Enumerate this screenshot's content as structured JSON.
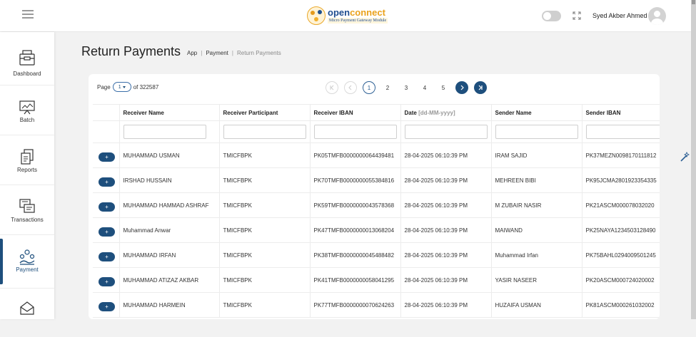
{
  "header": {
    "logo": {
      "name_part1": "open",
      "name_part2": "connect",
      "tagline": "Micro Payment Gateway Module"
    },
    "user_name": "Syed Akber Ahmed"
  },
  "sidebar": {
    "items": [
      {
        "label": "Dashboard",
        "icon": "dashboard-icon"
      },
      {
        "label": "Batch",
        "icon": "batch-icon"
      },
      {
        "label": "Reports",
        "icon": "reports-icon"
      },
      {
        "label": "Transactions",
        "icon": "transactions-icon"
      },
      {
        "label": "Payment",
        "icon": "payment-icon",
        "active": true
      },
      {
        "label": "",
        "icon": "inbox-icon"
      }
    ]
  },
  "page": {
    "title": "Return Payments",
    "breadcrumb": [
      "App",
      "Payment",
      "Return Payments"
    ]
  },
  "pagination": {
    "page_label": "Page",
    "current_page": "1",
    "of_label": "of 322587",
    "pages": [
      "1",
      "2",
      "3",
      "4",
      "5"
    ]
  },
  "table": {
    "columns": [
      "Receiver Name",
      "Receiver Participant",
      "Receiver IBAN",
      "Date",
      "Sender Name",
      "Sender IBAN"
    ],
    "date_hint": "[dd-MM-yyyy]",
    "add_label": "+",
    "rows": [
      [
        "MUHAMMAD USMAN",
        "TMICFBPK",
        "PK05TMFB0000000064439481",
        "28-04-2025 06:10:39 PM",
        "IRAM SAJID",
        "PK37MEZN0098170111812"
      ],
      [
        "IRSHAD HUSSAIN",
        "TMICFBPK",
        "PK70TMFB0000000055384816",
        "28-04-2025 06:10:39 PM",
        "MEHREEN BIBI",
        "PK95JCMA2801923354335"
      ],
      [
        "MUHAMMAD HAMMAD ASHRAF",
        "TMICFBPK",
        "PK59TMFB0000000043578368",
        "28-04-2025 06:10:39 PM",
        "M ZUBAIR NASIR",
        "PK21ASCM000078032020"
      ],
      [
        "Muhammad Anwar",
        "TMICFBPK",
        "PK47TMFB0000000013068204",
        "28-04-2025 06:10:39 PM",
        "MAIWAND",
        "PK25NAYA1234503128490"
      ],
      [
        "MUHAMMAD IRFAN",
        "TMICFBPK",
        "PK38TMFB0000000045488482",
        "28-04-2025 06:10:39 PM",
        "Muhammad Irfan",
        "PK75BAHL0294009501245"
      ],
      [
        "MUHAMMAD ATIZAZ AKBAR",
        "TMICFBPK",
        "PK41TMFB0000000058041295",
        "28-04-2025 06:10:39 PM",
        "YASIR NASEER",
        "PK20ASCM000724020002"
      ],
      [
        "MUHAMMAD HARMEIN",
        "TMICFBPK",
        "PK77TMFB0000000070624263",
        "28-04-2025 06:10:39 PM",
        "HUZAIFA USMAN",
        "PK81ASCM000261032002"
      ]
    ]
  },
  "colors": {
    "primary": "#1e4f7d",
    "accent": "#eaa21c"
  }
}
